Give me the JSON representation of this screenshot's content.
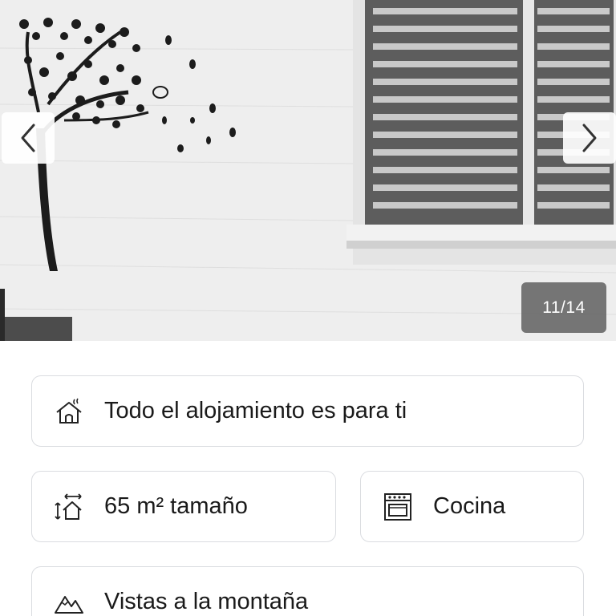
{
  "gallery": {
    "counter": "11/14",
    "prev_icon": "chevron-left-icon",
    "next_icon": "chevron-right-icon"
  },
  "features": {
    "lodging": {
      "icon": "house-icon",
      "label": "Todo el alojamiento es para ti"
    },
    "size": {
      "icon": "area-size-icon",
      "label": "65 m² tamaño"
    },
    "kitchen": {
      "icon": "oven-icon",
      "label": "Cocina"
    },
    "views": {
      "icon": "mountain-icon",
      "label": "Vistas a la montaña"
    }
  },
  "colors": {
    "card_border": "#dadce0",
    "counter_bg": "#5a5a5a",
    "text": "#1a1a1a"
  }
}
